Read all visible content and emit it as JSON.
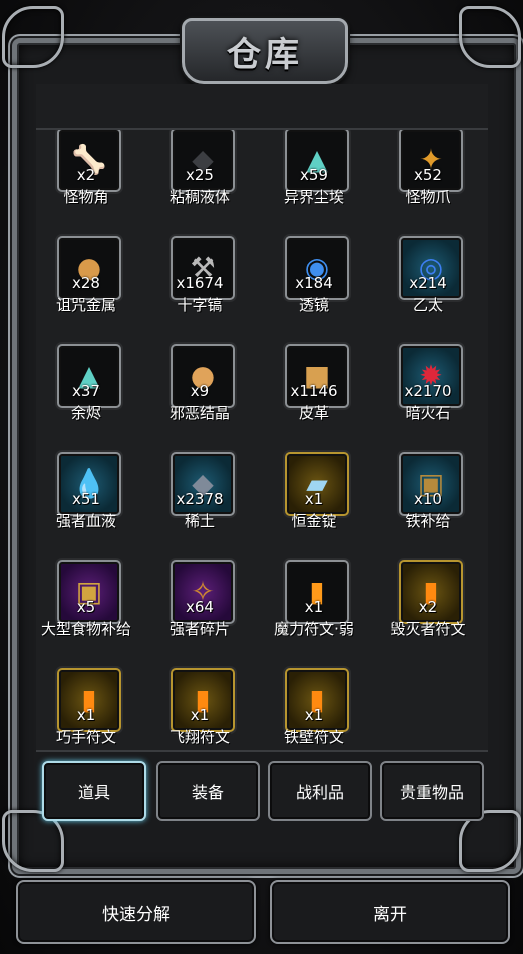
{
  "title": "仓库",
  "items": [
    {
      "name": "怪物角",
      "qty": "x2",
      "icon": "horn-icon",
      "glyph": "🦴",
      "color": "#d9d9d9",
      "style": ""
    },
    {
      "name": "粘稠液体",
      "qty": "x25",
      "icon": "slime-icon",
      "glyph": "◆",
      "color": "#3c3e42",
      "style": ""
    },
    {
      "name": "异界尘埃",
      "qty": "x59",
      "icon": "dust-icon",
      "glyph": "▲",
      "color": "#5fd0c5",
      "style": ""
    },
    {
      "name": "怪物爪",
      "qty": "x52",
      "icon": "claw-icon",
      "glyph": "✦",
      "color": "#e09a2a",
      "style": ""
    },
    {
      "name": "诅咒金属",
      "qty": "x28",
      "icon": "cursed-metal-icon",
      "glyph": "●",
      "color": "#d99a4a",
      "style": ""
    },
    {
      "name": "十字镐",
      "qty": "x1674",
      "icon": "pickaxe-icon",
      "glyph": "⚒",
      "color": "#b9b9b9",
      "style": ""
    },
    {
      "name": "透镜",
      "qty": "x184",
      "icon": "lens-icon",
      "glyph": "◉",
      "color": "#3f8ff0",
      "style": ""
    },
    {
      "name": "乙太",
      "qty": "x214",
      "icon": "ether-icon",
      "glyph": "◎",
      "color": "#3d7ff2",
      "style": "teal"
    },
    {
      "name": "余烬",
      "qty": "x37",
      "icon": "ember-icon",
      "glyph": "▲",
      "color": "#5fd0c5",
      "style": ""
    },
    {
      "name": "邪恶结晶",
      "qty": "x9",
      "icon": "evil-crystal-icon",
      "glyph": "●",
      "color": "#e0a35a",
      "style": ""
    },
    {
      "name": "皮革",
      "qty": "x1146",
      "icon": "leather-icon",
      "glyph": "■",
      "color": "#d8a050",
      "style": ""
    },
    {
      "name": "暗火石",
      "qty": "x2170",
      "icon": "dark-fire-stone-icon",
      "glyph": "✹",
      "color": "#e0273a",
      "style": "teal"
    },
    {
      "name": "强者血液",
      "qty": "x51",
      "icon": "blood-icon",
      "glyph": "💧",
      "color": "#e02020",
      "style": "teal"
    },
    {
      "name": "稀土",
      "qty": "x2378",
      "icon": "rare-earth-icon",
      "glyph": "◆",
      "color": "#7f8a99",
      "style": "teal"
    },
    {
      "name": "恒金锭",
      "qty": "x1",
      "icon": "ingot-icon",
      "glyph": "▰",
      "color": "#9fd6f2",
      "style": "gold"
    },
    {
      "name": "铁补给",
      "qty": "x10",
      "icon": "iron-supply-icon",
      "glyph": "▣",
      "color": "#b58a3c",
      "style": "teal"
    },
    {
      "name": "大型食物补给",
      "qty": "x5",
      "icon": "food-supply-icon",
      "glyph": "▣",
      "color": "#d2a440",
      "style": "purple"
    },
    {
      "name": "强者碎片",
      "qty": "x64",
      "icon": "fragment-icon",
      "glyph": "✧",
      "color": "#d08a30",
      "style": "purple"
    },
    {
      "name": "魔力符文·弱",
      "qty": "x1",
      "icon": "mana-rune-icon",
      "glyph": "▮",
      "color": "#ff9a1a",
      "style": ""
    },
    {
      "name": "毁灭者符文",
      "qty": "x2",
      "icon": "destroyer-rune-icon",
      "glyph": "▮",
      "color": "#ff8a10",
      "style": "gold"
    },
    {
      "name": "巧手符文",
      "qty": "x1",
      "icon": "dexterity-rune-icon",
      "glyph": "▮",
      "color": "#ff8a10",
      "style": "gold"
    },
    {
      "name": "飞翔符文",
      "qty": "x1",
      "icon": "flight-rune-icon",
      "glyph": "▮",
      "color": "#ff8a10",
      "style": "gold"
    },
    {
      "name": "铁壁符文",
      "qty": "x1",
      "icon": "iron-wall-rune-icon",
      "glyph": "▮",
      "color": "#ff8a10",
      "style": "gold"
    }
  ],
  "tabs": [
    {
      "label": "道具",
      "active": true
    },
    {
      "label": "装备",
      "active": false
    },
    {
      "label": "战利品",
      "active": false
    },
    {
      "label": "贵重物品",
      "active": false
    }
  ],
  "buttons": {
    "quick_disassemble": "快速分解",
    "leave": "离开"
  }
}
